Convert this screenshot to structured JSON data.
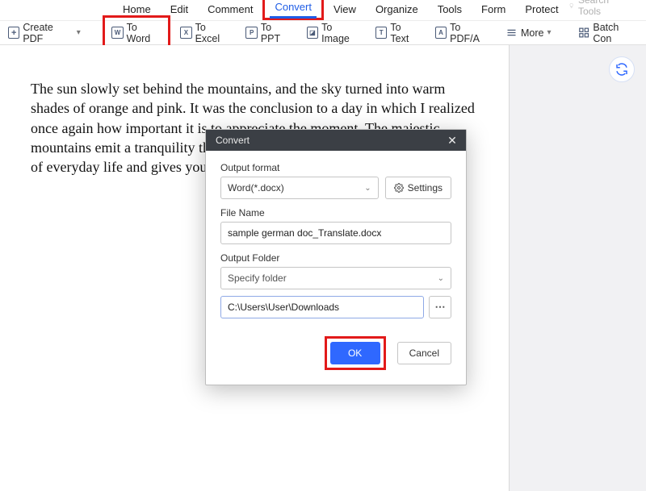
{
  "tabs": [
    "Home",
    "Edit",
    "Comment",
    "Convert",
    "View",
    "Organize",
    "Tools",
    "Form",
    "Protect"
  ],
  "searchTools": "Search Tools",
  "toolbar": {
    "createPdf": "Create PDF",
    "toWord": "To Word",
    "toExcel": "To Excel",
    "toPpt": "To PPT",
    "toImage": "To Image",
    "toText": "To Text",
    "toPdfa": "To PDF/A",
    "more": "More",
    "batch": "Batch Con"
  },
  "documentText": "The sun slowly set behind the mountains, and the sky turned into warm shades of orange and pink. It was the conclusion to a day in which I realized once again how important it is to appreciate the moment. The majestic mountains emit a tranquility that lets you forget everything about the stress of everyday life and gives you gratitude for the wonders of nature.",
  "dialog": {
    "title": "Convert",
    "outputFormatLabel": "Output format",
    "outputFormatValue": "Word(*.docx)",
    "settings": "Settings",
    "fileNameLabel": "File Name",
    "fileNameValue": "sample german doc_Translate.docx",
    "outputFolderLabel": "Output Folder",
    "outputFolderMode": "Specify folder",
    "outputPath": "C:\\Users\\User\\Downloads",
    "ok": "OK",
    "cancel": "Cancel"
  }
}
